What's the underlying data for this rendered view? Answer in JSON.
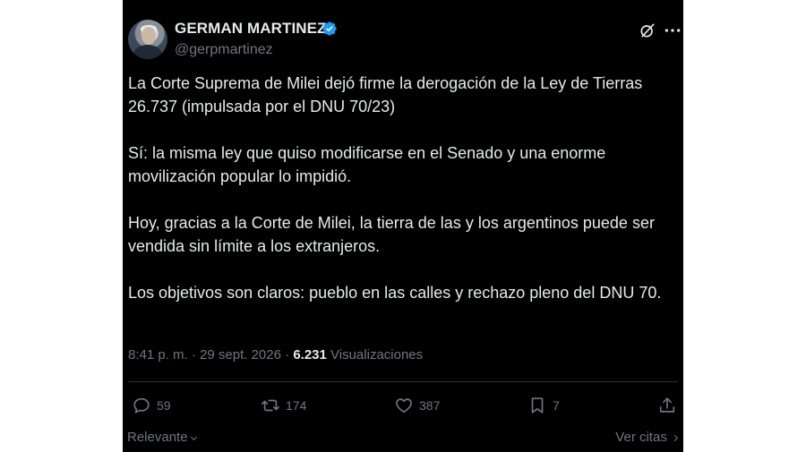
{
  "author": {
    "display_name": "GERMAN MARTINEZ",
    "handle": "@gerpmartinez",
    "verified_icon": "verified-badge-icon",
    "avatar_icon": "avatar"
  },
  "header_icons": {
    "grok": "grok-icon",
    "more": "more-icon"
  },
  "tweet": {
    "paragraphs": [
      "La Corte Suprema de Milei dejó firme la derogación de la Ley de Tierras 26.737 (impulsada por el DNU 70/23)",
      "Sí: la misma ley que quiso modificarse en el Senado y una enorme movilización popular lo impidió.",
      "Hoy, gracias a la Corte de Milei, la tierra de las y los argentinos puede ser vendida sin límite a los extranjeros.",
      "Los objetivos son claros: pueblo en las calles y rechazo pleno del DNU 70."
    ]
  },
  "meta": {
    "time": "8:41 p. m.",
    "separator1": " · ",
    "date": "29 sept. 2026",
    "separator2": " · ",
    "views_count": "6.231",
    "views_label": " Visualizaciones"
  },
  "actions": {
    "replies": "59",
    "retweets": "174",
    "likes": "387",
    "bookmarks": "7"
  },
  "footer": {
    "sort_label": "Relevante",
    "sort_icon": "chevron-down-icon",
    "quotes_label": "Ver citas",
    "quotes_icon": "chevron-right-icon"
  },
  "colors": {
    "background": "#000000",
    "text": "#e7e9ea",
    "muted": "#71767b",
    "verified": "#1d9bf0",
    "divider": "#2f3336"
  }
}
